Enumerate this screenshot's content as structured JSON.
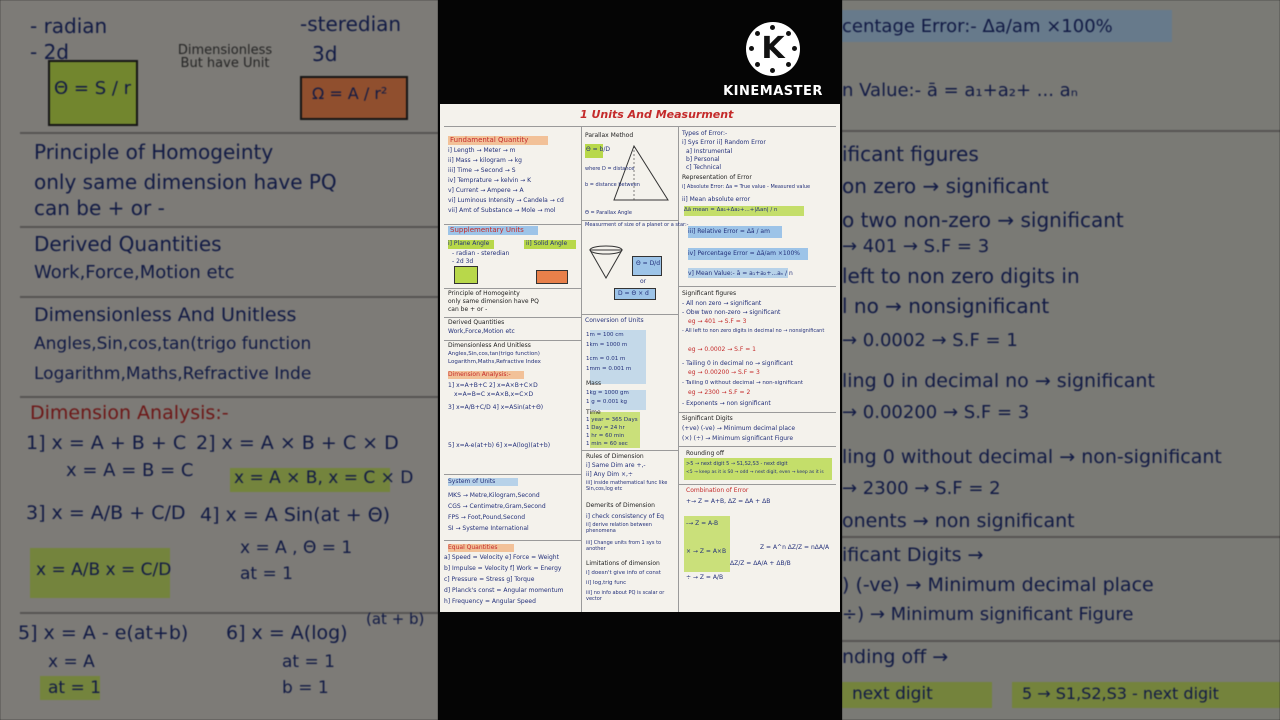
{
  "watermark": {
    "brand": "KINEMASTER",
    "logo_letter": "K"
  },
  "title": "1 Units And Measurment",
  "left_panel": {
    "lines": [
      "- radian",
      "- 2d",
      "Θ = S / r",
      "Dimensionless But have Unit",
      "-steredian",
      "3d",
      "Ω = A / r²",
      "Principle of Homogeinty",
      "only same dimension have PQ",
      "can be + or -",
      "Derived Quantities",
      "Work,Force,Motion etc",
      "Dimensionless And Unitless",
      "Angles,Sin,cos,tan(trigo function",
      "Logarithm,Maths,Refractive Inde",
      "Dimension Analysis:-",
      "1] x = A + B + C",
      "x = A = B = C",
      "2] x = A × B + C × D",
      "x = A × B, x = C × D",
      "3] x = A/B + C/D",
      "4] x = A Sin(at + Θ)",
      "x = A , Θ = 1",
      "at = 1",
      "x = A/B  x = C/D",
      "5] x = A - e(at+b)",
      "x = A",
      "at = 1",
      "6] x = A(log)",
      "(at + b)",
      "at = 1",
      "b = 1"
    ]
  },
  "right_panel": {
    "lines": [
      "centage Error:- Δa/am ×100%",
      "n Value:- ā = a₁+a₂+ ... aₙ",
      "ificant figures",
      "on zero → significant",
      "o two non-zero → significant",
      "→ 401 → S.F = 3",
      "left to non zero digits in",
      "l no → nonsignificant",
      "→ 0.0002 → S.F = 1",
      "ling 0 in decimal no → significant",
      "→ 0.00200 → S.F = 3",
      "ling 0 without decimal → non-significant",
      "→ 2300 → S.F = 2",
      "onents → non significant",
      "ificant Digits →",
      ") (-ve) → Minimum decimal place",
      "÷) → Minimum significant Figure",
      "nding off →",
      "next digit",
      "5 → S1,S2,S3 - next digit"
    ]
  },
  "notes": {
    "col1": [
      "Fundamental Quantity",
      "i] Length → Meter → m",
      "ii] Mass → kilogram → kg",
      "iii] Time → Second → S",
      "iv] Temprature → kelvin → K",
      "v] Current → Ampere → A",
      "vi] Luminous Intensity → Candela → cd",
      "vii] Amt of Substance → Mole → mol",
      "Supplementary Units",
      "i] Plane Angle",
      "ii] Solid Angle",
      "- radian   - steredian",
      "- 2d        3d",
      "Principle of Homogeinty",
      "only same dimension have PQ",
      "can be + or -",
      "Derived Quantities",
      "Work,Force,Motion etc",
      "Dimensionless And Unitless",
      "Angles,Sin,cos,tan(trigo function)",
      "Logarithm,Maths,Refractive Index",
      "Dimension Analysis:-",
      "1] x=A+B+C   2] x=A×B+C×D",
      "x=A=B=C     x=A×B,x=C×D",
      "3] x=A/B+C/D  4] x=ASin(at+Θ)",
      "5] x=A-e(at+b)  6] x=A(log)(at+b)",
      "System of Units",
      "MKS → Metre,Kilogram,Second",
      "CGS → Centimetre,Gram,Second",
      "FPS → Foot,Pound,Second",
      "SI → Systeme International",
      "Equal Quantities",
      "a] Speed = Velocity   e] Force = Weight",
      "b] Impulse = Velocity  f] Work = Energy",
      "c] Pressure = Stress   g] Torque",
      "d] Planck's const = Angular momentum",
      "h] Frequency = Angular Speed"
    ],
    "col2": [
      "Parallax Method",
      "Θ = b/D",
      "where D = distance",
      "b = distance between",
      "Θ = Parallax Angle",
      "Measurment of size of a planet or a star:-",
      "Θ = D/d",
      "or",
      "D = Θ × d",
      "Conversion of Units",
      "1m = 100 cm",
      "1km = 1000 m",
      "1cm = 0.01 m",
      "1mm = 0.001 m",
      "Mass",
      "1kg = 1000 gm",
      "1 g = 0.001 kg",
      "Time",
      "1 year = 365 Days",
      "1 Day = 24 hr",
      "1 hr = 60 min",
      "1 min = 60 sec",
      "Rules of Dimension",
      "i] Same Dim are +,-",
      "ii] Any Dim ×,÷",
      "iii] inside mathematical func like Sin,cos,log etc",
      "Demerits of Dimension",
      "i] check consistency of Eq",
      "ii] derive relation between phenomena",
      "iii] Change units from 1 sys to another",
      "Limitations of dimension",
      "i] doesn't give info of const",
      "ii] log,trig func",
      "iii] no info about PQ is scalar or vector"
    ],
    "col3": [
      "Types of Error:-",
      "i] Sys Error   ii] Random Error",
      "a] Instrumental",
      "b] Personal",
      "c] Technical",
      "Representation of Error",
      "i] Absolute Error: Δa = True value - Measured value",
      "ii] Mean absolute error",
      "Δā mean = Δa₁+Δa₂+...+|Δan| / n",
      "iii] Relative Error = Δā / am",
      "iv] Percentage Error = Δā/am ×100%",
      "v] Mean Value:- ā = a₁+a₂+...aₙ / n",
      "Significant figures",
      "- All non zero → significant",
      "- Obw two non-zero → significant",
      "eg → 401 → S.F = 3",
      "- All left to non zero digits in decimal no → nonsignificant",
      "eg → 0.0002 → S.F = 1",
      "- Tailing 0 in decimal no → significant",
      "eg → 0.00200 → S.F = 3",
      "- Tailing 0 without decimal → non-significant",
      "eg → 2300 → S.F = 2",
      "- Exponents → non significant",
      "Significant Digits",
      "(+ve) (-ve) → Minimum decimal place",
      "(×) (÷) → Minimum significant Figure",
      "Rounding off",
      ">5 → next digit   5 → S1,S2,S3 - next digit",
      "<5 → keep as it is   S0 → odd → next digit, even → keep as it is",
      "Combination of Error",
      "+→ Z = A+B,  ΔZ = ΔA + ΔB",
      "-→ Z = A-B",
      "× → Z = A×B",
      "÷ → Z = A/B",
      "ΔZ/Z = ΔA/A + ΔB/B",
      "Z = A^n  ΔZ/Z = nΔA/A"
    ]
  },
  "colors": {
    "ink_blue": "#1c2a6e",
    "ink_red": "#c42a2a",
    "highlight_green": "#b8d84a",
    "highlight_blue": "#9dc4e8",
    "highlight_orange": "#e8804a",
    "paper": "#f4f2ec"
  }
}
